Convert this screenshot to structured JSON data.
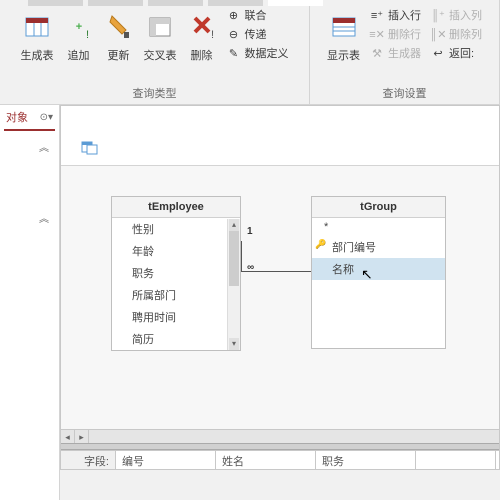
{
  "ribbon": {
    "groups": {
      "query_type": {
        "label": "查询类型",
        "make_table": "生成表",
        "append": "追加",
        "update": "更新",
        "crosstab": "交叉表",
        "delete": "删除",
        "union": "联合",
        "passthrough": "传递",
        "data_def": "数据定义"
      },
      "query_setup": {
        "label": "查询设置",
        "show_table": "显示表",
        "insert_row": "插入行",
        "delete_row": "删除行",
        "builder": "生成器",
        "insert_col": "插入列",
        "delete_col": "删除列",
        "return": "返回:"
      }
    }
  },
  "left_pane": {
    "title": "对象",
    "collapse": "«"
  },
  "tables": {
    "employee": {
      "title": "tEmployee",
      "fields": [
        "性别",
        "年龄",
        "职务",
        "所属部门",
        "聘用时间",
        "简历"
      ]
    },
    "group": {
      "title": "tGroup",
      "star": "*",
      "fields": [
        "部门编号",
        "名称"
      ]
    }
  },
  "relation": {
    "left": "1",
    "right": "∞"
  },
  "grid": {
    "row_label": "字段:",
    "c1": "编号",
    "c2": "姓名",
    "c3": "职务"
  }
}
